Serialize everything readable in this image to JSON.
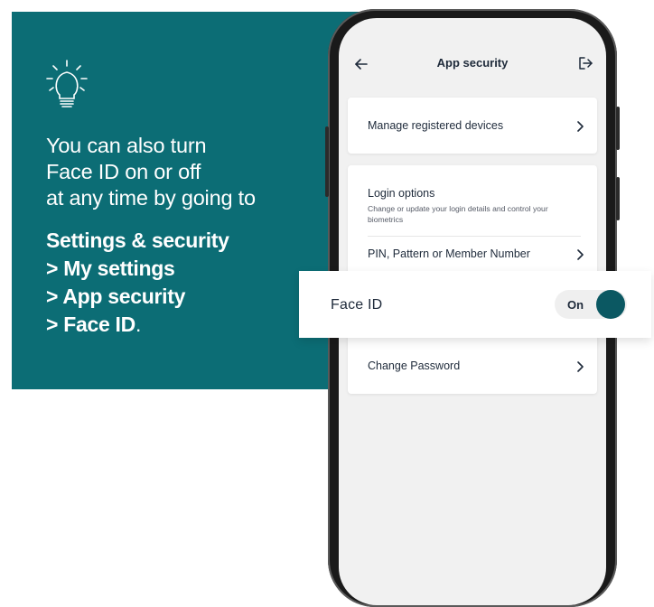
{
  "promo": {
    "intro_lines": [
      "You can also turn",
      "Face ID on or off",
      "at any time by going to"
    ],
    "path_lines": [
      "Settings & security",
      "> My settings",
      "> App security",
      "> Face ID"
    ],
    "path_end": ".",
    "icon": "lightbulb-icon"
  },
  "app": {
    "title": "App security",
    "back_icon": "arrow-left-icon",
    "logout_icon": "logout-icon",
    "manage_devices": "Manage registered devices",
    "login_options": {
      "title": "Login options",
      "description": "Change or update your login details and control your biometrics",
      "pin_row": "PIN, Pattern or Member Number"
    },
    "change_password": "Change Password"
  },
  "faceid": {
    "label": "Face ID",
    "toggle_state": "On",
    "toggle_on": true
  },
  "colors": {
    "panel": "#0c6d75",
    "knob": "#0b5862",
    "text": "#1e2a3a"
  }
}
